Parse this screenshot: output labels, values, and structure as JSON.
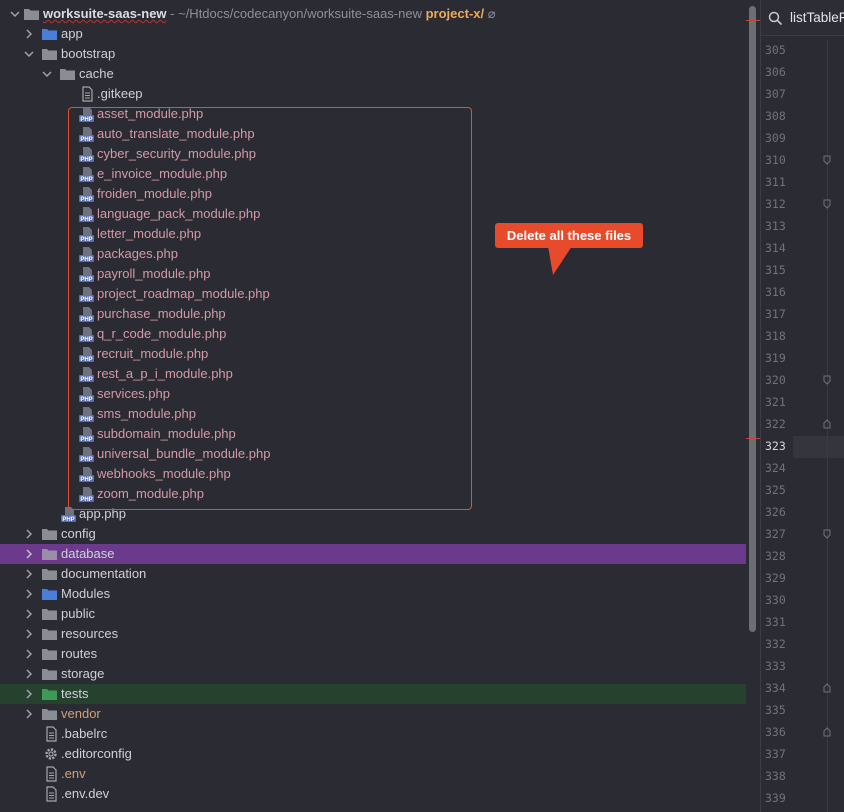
{
  "root": {
    "name": "worksuite-saas-new",
    "path": " - ~/Htdocs/codecanyon/worksuite-saas-new",
    "branch": "project-x/",
    "branch_symbol": "⌀"
  },
  "tree": {
    "app": "app",
    "bootstrap": "bootstrap",
    "cache": "cache",
    "gitkeep": ".gitkeep",
    "cache_files": [
      "asset_module.php",
      "auto_translate_module.php",
      "cyber_security_module.php",
      "e_invoice_module.php",
      "froiden_module.php",
      "language_pack_module.php",
      "letter_module.php",
      "packages.php",
      "payroll_module.php",
      "project_roadmap_module.php",
      "purchase_module.php",
      "q_r_code_module.php",
      "recruit_module.php",
      "rest_a_p_i_module.php",
      "services.php",
      "sms_module.php",
      "subdomain_module.php",
      "universal_bundle_module.php",
      "webhooks_module.php",
      "zoom_module.php"
    ],
    "app_php": "app.php",
    "config": "config",
    "database": "database",
    "documentation": "documentation",
    "modules": "Modules",
    "public": "public",
    "resources": "resources",
    "routes": "routes",
    "storage": "storage",
    "tests": "tests",
    "vendor": "vendor",
    "babelrc": ".babelrc",
    "editorconfig": ".editorconfig",
    "env": ".env",
    "env_dev": ".env.dev"
  },
  "annotation": {
    "callout_text": "Delete all these files"
  },
  "editor": {
    "tab_title": "listTableF",
    "line_numbers": [
      "305",
      "306",
      "307",
      "308",
      "309",
      "310",
      "311",
      "312",
      "313",
      "314",
      "315",
      "316",
      "317",
      "318",
      "319",
      "320",
      "321",
      "322",
      "323",
      "324",
      "325",
      "326",
      "327",
      "328",
      "329",
      "330",
      "331",
      "332",
      "333",
      "334",
      "335",
      "336",
      "337",
      "338",
      "339"
    ],
    "current_line": "323"
  },
  "colors": {
    "accent_annotation": "#e84b2c",
    "selection_purple": "#6b3a8c",
    "selection_green": "#26422f",
    "php_file_text": "#d49aa7",
    "folder_blue": "#4a7fd9",
    "folder_gray": "#8a8d93"
  },
  "icons": {
    "php_file": "php-file-icon",
    "folder": "folder-icon",
    "chevron": "chevron-icon",
    "gear": "gear-icon",
    "text_file": "text-file-icon",
    "search": "search-icon"
  }
}
